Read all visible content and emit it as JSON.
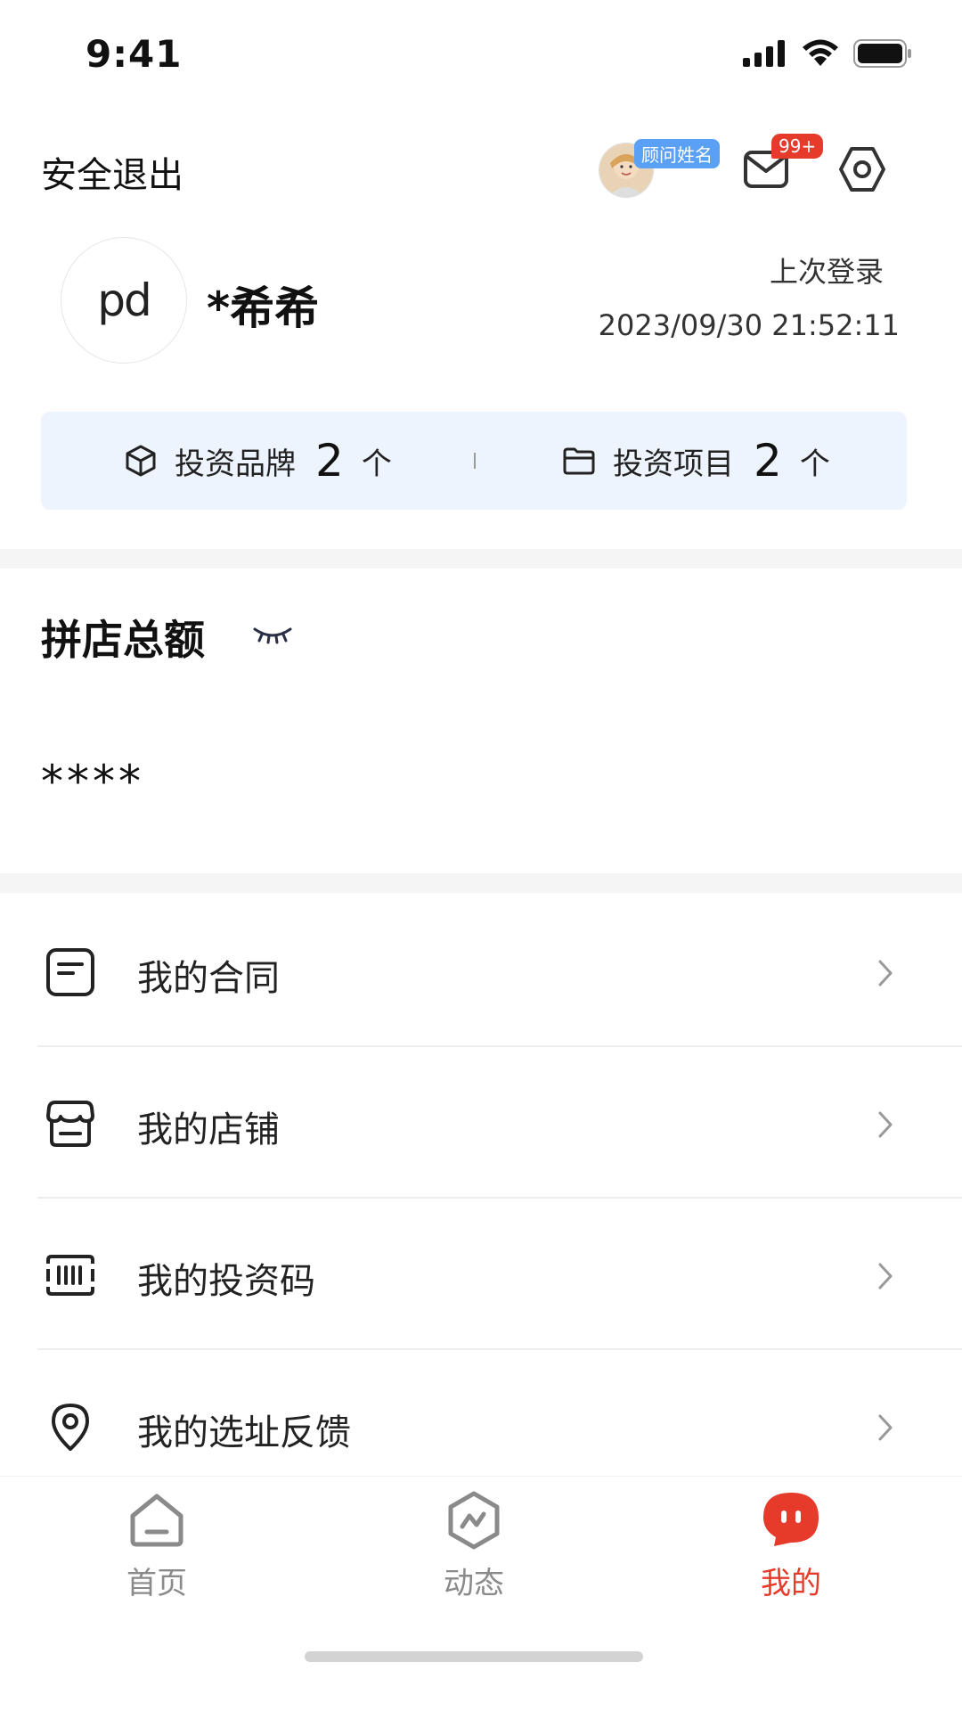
{
  "status_bar": {
    "time": "9:41"
  },
  "header": {
    "logout_label": "安全退出",
    "advisor_tag": "顾问姓名",
    "mail_badge": "99+"
  },
  "profile": {
    "logo_text": "pd",
    "username": "*希希",
    "last_login_label": "上次登录",
    "last_login_time": "2023/09/30 21:52:11"
  },
  "stats": {
    "brands": {
      "label": "投资品牌",
      "value": "2",
      "unit": "个"
    },
    "projects": {
      "label": "投资项目",
      "value": "2",
      "unit": "个"
    }
  },
  "total": {
    "title": "拼店总额",
    "value": "****"
  },
  "menu": {
    "items": [
      {
        "label": "我的合同",
        "icon": "contract-icon"
      },
      {
        "label": "我的店铺",
        "icon": "store-icon"
      },
      {
        "label": "我的投资码",
        "icon": "barcode-icon"
      },
      {
        "label": "我的选址反馈",
        "icon": "location-pin-icon"
      }
    ]
  },
  "tabbar": {
    "tabs": [
      {
        "label": "首页",
        "icon": "home-icon"
      },
      {
        "label": "动态",
        "icon": "activity-icon"
      },
      {
        "label": "我的",
        "icon": "profile-icon",
        "active": true
      }
    ]
  },
  "colors": {
    "accent": "#e63b2b",
    "stats_bg": "#eef4fd",
    "advisor_tag": "#5aa0f5"
  }
}
